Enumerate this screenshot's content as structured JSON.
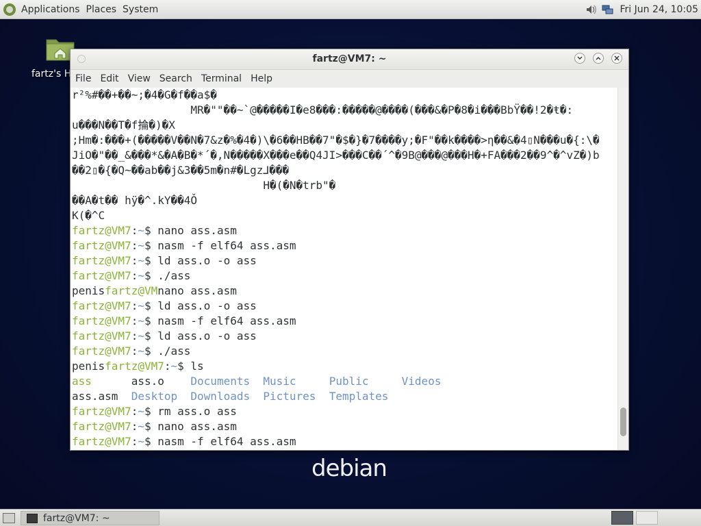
{
  "top_panel": {
    "menus": [
      "Applications",
      "Places",
      "System"
    ],
    "clock": "Fri Jun 24, 10:05",
    "icons": [
      "debian-menu-icon",
      "volume-icon",
      "network-icon"
    ]
  },
  "desktop": {
    "home_icon_label": "fartz's H",
    "logo_text": "debian"
  },
  "window": {
    "title": "fartz@VM7: ~",
    "menus": [
      "File",
      "Edit",
      "View",
      "Search",
      "Terminal",
      "Help"
    ]
  },
  "terminal_lines": [
    {
      "parts": [
        {
          "t": "r²%#��+��~;�4�G�f��a$�",
          "c": "w"
        }
      ]
    },
    {
      "parts": [
        {
          "t": "                  MR�\"\"��~`@�����I�e8���:�����@����(���&�P�8�i���BbŸ��!2�ŧ�:",
          "c": "w"
        }
      ]
    },
    {
      "parts": [
        {
          "t": "u���N��T�f掄�)�X",
          "c": "w"
        }
      ]
    },
    {
      "parts": [
        {
          "t": ";Hm�:���+(�����V��N�7&z�%�4�)\\�6��HB��7\"�$�}�7����y;�F\"��k����>η��&�4▯N���u�{:\\�",
          "c": "w"
        }
      ]
    },
    {
      "parts": [
        {
          "t": "JiO�\"��_&���*&�A�B�*´�,N�����X���e��Q4JI>���C��´^�9B@���@���H�+FA���2��9^�^vZ�)b",
          "c": "w"
        }
      ]
    },
    {
      "parts": [
        {
          "t": "��2▯�{�Q~��ab��j&3��5m�n#�Lgz⅃���",
          "c": "w"
        }
      ]
    },
    {
      "parts": [
        {
          "t": "                             H�(�N�trb\"�",
          "c": "w"
        }
      ]
    },
    {
      "parts": [
        {
          "t": "��A�t�� hÿ�^.kY��4Ǒ",
          "c": "w"
        }
      ]
    },
    {
      "parts": [
        {
          "t": "K(�^C",
          "c": "w"
        }
      ]
    },
    {
      "parts": [
        {
          "t": "fartz@VM7",
          "c": "g"
        },
        {
          "t": ":",
          "c": "w"
        },
        {
          "t": "~",
          "c": "b"
        },
        {
          "t": "$ nano ass.asm",
          "c": "w"
        }
      ]
    },
    {
      "parts": [
        {
          "t": "fartz@VM7",
          "c": "g"
        },
        {
          "t": ":",
          "c": "w"
        },
        {
          "t": "~",
          "c": "b"
        },
        {
          "t": "$ nasm -f elf64 ass.asm",
          "c": "w"
        }
      ]
    },
    {
      "parts": [
        {
          "t": "fartz@VM7",
          "c": "g"
        },
        {
          "t": ":",
          "c": "w"
        },
        {
          "t": "~",
          "c": "b"
        },
        {
          "t": "$ ld ass.o -o ass",
          "c": "w"
        }
      ]
    },
    {
      "parts": [
        {
          "t": "fartz@VM7",
          "c": "g"
        },
        {
          "t": ":",
          "c": "w"
        },
        {
          "t": "~",
          "c": "b"
        },
        {
          "t": "$ ./ass",
          "c": "w"
        }
      ]
    },
    {
      "parts": [
        {
          "t": "penis",
          "c": "w"
        },
        {
          "t": "fartz@VM",
          "c": "g"
        },
        {
          "t": "nano ass.asm",
          "c": "w"
        }
      ]
    },
    {
      "parts": [
        {
          "t": "fartz@VM7",
          "c": "g"
        },
        {
          "t": ":",
          "c": "w"
        },
        {
          "t": "~",
          "c": "b"
        },
        {
          "t": "$ ld ass.o -o ass",
          "c": "w"
        }
      ]
    },
    {
      "parts": [
        {
          "t": "fartz@VM7",
          "c": "g"
        },
        {
          "t": ":",
          "c": "w"
        },
        {
          "t": "~",
          "c": "b"
        },
        {
          "t": "$ nasm -f elf64 ass.asm",
          "c": "w"
        }
      ]
    },
    {
      "parts": [
        {
          "t": "fartz@VM7",
          "c": "g"
        },
        {
          "t": ":",
          "c": "w"
        },
        {
          "t": "~",
          "c": "b"
        },
        {
          "t": "$ ld ass.o -o ass",
          "c": "w"
        }
      ]
    },
    {
      "parts": [
        {
          "t": "fartz@VM7",
          "c": "g"
        },
        {
          "t": ":",
          "c": "w"
        },
        {
          "t": "~",
          "c": "b"
        },
        {
          "t": "$ ./ass",
          "c": "w"
        }
      ]
    },
    {
      "parts": [
        {
          "t": "penis",
          "c": "w"
        },
        {
          "t": "fartz@VM7",
          "c": "g"
        },
        {
          "t": ":",
          "c": "w"
        },
        {
          "t": "~",
          "c": "b"
        },
        {
          "t": "$ ls",
          "c": "w"
        }
      ]
    },
    {
      "parts": [
        {
          "t": "ass",
          "c": "g"
        },
        {
          "t": "      ass.o    ",
          "c": "w"
        },
        {
          "t": "Documents  Music     Public     Videos",
          "c": "b"
        }
      ]
    },
    {
      "parts": [
        {
          "t": "ass.asm  ",
          "c": "w"
        },
        {
          "t": "Desktop  Downloads  Pictures  Templates",
          "c": "b"
        }
      ]
    },
    {
      "parts": [
        {
          "t": "fartz@VM7",
          "c": "g"
        },
        {
          "t": ":",
          "c": "w"
        },
        {
          "t": "~",
          "c": "b"
        },
        {
          "t": "$ rm ass.o ass",
          "c": "w"
        }
      ]
    },
    {
      "parts": [
        {
          "t": "fartz@VM7",
          "c": "g"
        },
        {
          "t": ":",
          "c": "w"
        },
        {
          "t": "~",
          "c": "b"
        },
        {
          "t": "$ nano ass.asm",
          "c": "w"
        }
      ]
    },
    {
      "parts": [
        {
          "t": "fartz@VM7",
          "c": "g"
        },
        {
          "t": ":",
          "c": "w"
        },
        {
          "t": "~",
          "c": "b"
        },
        {
          "t": "$ nasm -f elf64 ass.asm",
          "c": "w"
        }
      ]
    }
  ],
  "bottom_panel": {
    "task_label": "fartz@VM7: ~"
  },
  "colors": {
    "prompt_user": "#8ab437",
    "prompt_path": "#6f93c4",
    "text": "#2e3436",
    "desktop_bg": "#071033"
  }
}
